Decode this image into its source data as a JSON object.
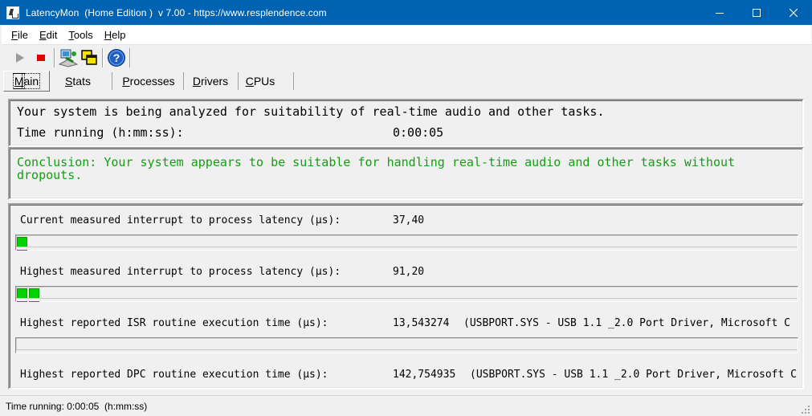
{
  "window": {
    "title": "LatencyMon  (Home Edition )  v 7.00 - https://www.resplendence.com"
  },
  "menu": {
    "items": [
      {
        "accel": "F",
        "rest": "ile"
      },
      {
        "accel": "E",
        "rest": "dit"
      },
      {
        "accel": "T",
        "rest": "ools"
      },
      {
        "accel": "H",
        "rest": "elp"
      }
    ]
  },
  "toolbar": {
    "buttons": [
      "play-icon",
      "stop-icon",
      "computer-analyze-icon",
      "windows-icon",
      "help-icon"
    ]
  },
  "tabs": [
    {
      "accel": "M",
      "rest": "ain"
    },
    {
      "accel": "S",
      "rest": "tats"
    },
    {
      "accel": "P",
      "rest": "rocesses"
    },
    {
      "accel": "D",
      "rest": "rivers"
    },
    {
      "accel": "C",
      "rest": "PUs"
    }
  ],
  "status": {
    "message": "Your system is being analyzed for suitability of real-time audio and other tasks.",
    "time_label": "Time running (h:mm:ss):",
    "time_value": "0:00:05"
  },
  "conclusion": "Conclusion: Your system appears to be suitable for handling real-time audio and other tasks without dropouts.",
  "metrics": {
    "current_latency": {
      "label": "Current measured interrupt to process latency (µs):",
      "value": "37,40",
      "segments": 1
    },
    "highest_latency": {
      "label": "Highest measured interrupt to process latency (µs):",
      "value": "91,20",
      "segments": 2
    },
    "isr": {
      "label": "Highest reported ISR routine execution time (µs):",
      "value": "13,543274",
      "driver": "(USBPORT.SYS - USB 1.1 _2.0 Port Driver, Microsoft C",
      "segments": 0
    },
    "dpc": {
      "label": "Highest reported DPC routine execution time (µs):",
      "value": "142,754935",
      "driver": "(USBPORT.SYS - USB 1.1 _2.0 Port Driver, Microsoft C"
    }
  },
  "statusbar": {
    "text": "Time running: 0:00:05  (h:mm:ss)"
  },
  "colors": {
    "titlebar": "#0063b1",
    "conclusion_text": "#12a012",
    "bar_segment": "#00d200"
  }
}
